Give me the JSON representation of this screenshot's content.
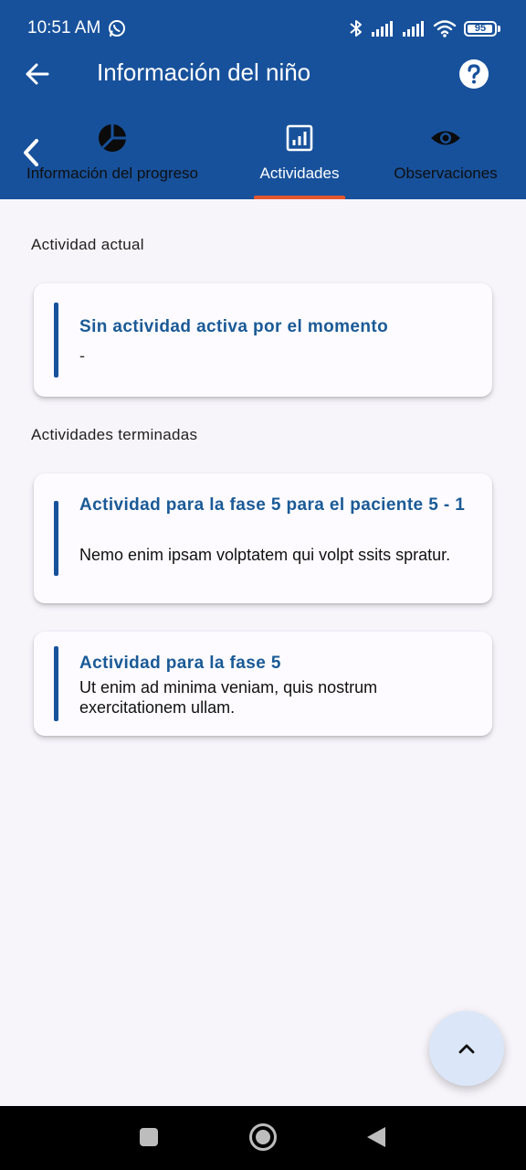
{
  "status_bar": {
    "time": "10:51 AM",
    "battery": "95",
    "battery_level": 0.95
  },
  "app_bar": {
    "title": "Información del niño",
    "back_icon": "arrow-left-icon",
    "help_icon": "help-circle-icon"
  },
  "tabs": [
    {
      "label": "Información del progreso",
      "icon": "pie-chart-icon",
      "selected": false
    },
    {
      "label": "Actividades",
      "icon": "bar-chart-icon",
      "selected": true
    },
    {
      "label": "Observaciones",
      "icon": "eye-icon",
      "selected": false
    }
  ],
  "colors": {
    "primary": "#17519b",
    "indicator": "#e4572e",
    "card_title": "#1a5a96",
    "background": "#f7f5fa",
    "fab": "#dbe6f8"
  },
  "current": {
    "section_label": "Actividad actual",
    "card": {
      "title": "Sin actividad activa por el momento",
      "description": "-"
    }
  },
  "finished": {
    "section_label": "Actividades terminadas",
    "cards": [
      {
        "title": "Actividad para la fase 5 para el paciente 5 - 1",
        "description": "Nemo enim ipsam volptatem qui volpt ssits spratur."
      },
      {
        "title": "Actividad para la fase 5",
        "description": "Ut enim ad minima veniam, quis nostrum exercitationem ullam."
      }
    ]
  },
  "fab": {
    "icon": "chevron-up-icon"
  },
  "nav_bar": {
    "buttons": [
      "recents-icon",
      "home-icon",
      "back-icon"
    ]
  }
}
